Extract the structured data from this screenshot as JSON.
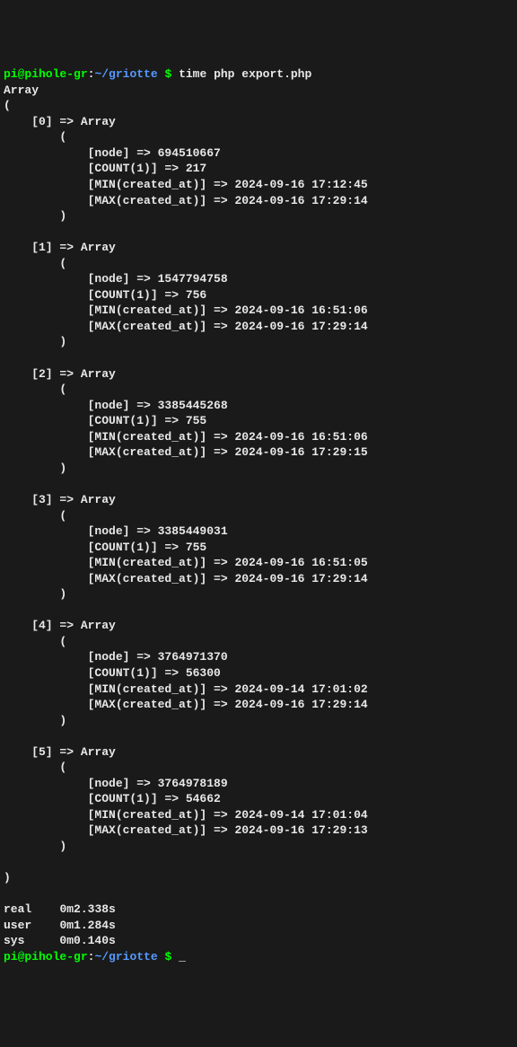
{
  "prompt": {
    "user_host": "pi@pihole-gr",
    "separator": ":",
    "path": "~/griotte",
    "dollar": " $ ",
    "command": "time php export.php"
  },
  "output_header": "Array\n(",
  "entries": [
    {
      "index": "0",
      "node": "694510667",
      "count": "217",
      "min": "2024-09-16 17:12:45",
      "max": "2024-09-16 17:29:14"
    },
    {
      "index": "1",
      "node": "1547794758",
      "count": "756",
      "min": "2024-09-16 16:51:06",
      "max": "2024-09-16 17:29:14"
    },
    {
      "index": "2",
      "node": "3385445268",
      "count": "755",
      "min": "2024-09-16 16:51:06",
      "max": "2024-09-16 17:29:15"
    },
    {
      "index": "3",
      "node": "3385449031",
      "count": "755",
      "min": "2024-09-16 16:51:05",
      "max": "2024-09-16 17:29:14"
    },
    {
      "index": "4",
      "node": "3764971370",
      "count": "56300",
      "min": "2024-09-14 17:01:02",
      "max": "2024-09-16 17:29:14"
    },
    {
      "index": "5",
      "node": "3764978189",
      "count": "54662",
      "min": "2024-09-14 17:01:04",
      "max": "2024-09-16 17:29:13"
    }
  ],
  "output_footer": ")",
  "timing": {
    "real_label": "real",
    "real_value": "0m2.338s",
    "user_label": "user",
    "user_value": "0m1.284s",
    "sys_label": "sys",
    "sys_value": "0m0.140s"
  },
  "prompt2": {
    "user_host": "pi@pihole-gr",
    "separator": ":",
    "path": "~/griotte",
    "dollar": " $ ",
    "cursor": "_"
  },
  "labels": {
    "arrow": " => ",
    "array_word": "Array",
    "open_paren": "(",
    "close_paren": ")",
    "node_key": "[node]",
    "count_key": "[COUNT(1)]",
    "min_key": "[MIN(created_at)]",
    "max_key": "[MAX(created_at)]"
  }
}
